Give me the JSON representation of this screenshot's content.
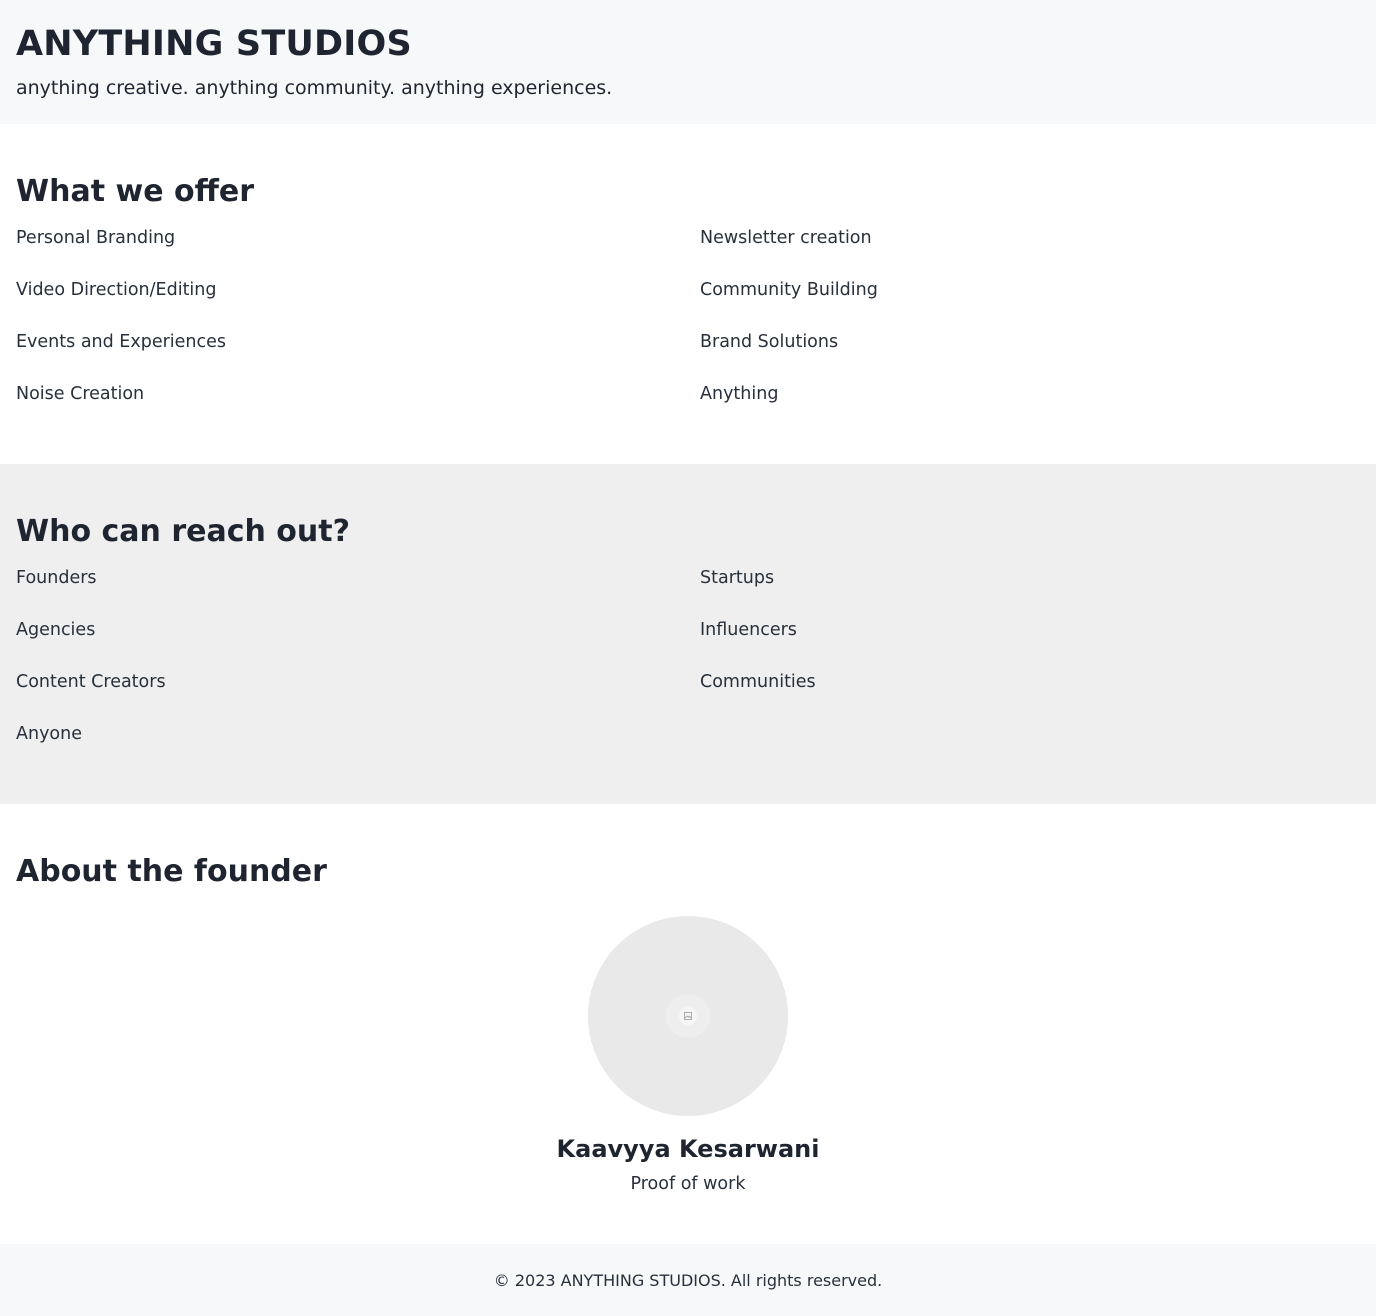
{
  "header": {
    "title": "ANYTHING STUDIOS",
    "tagline": "anything creative. anything community. anything experiences."
  },
  "offer": {
    "heading": "What we offer",
    "items": [
      "Personal Branding",
      "Newsletter creation",
      "Video Direction/Editing",
      "Community Building",
      "Events and Experiences",
      "Brand Solutions",
      "Noise Creation",
      "Anything"
    ]
  },
  "audience": {
    "heading": "Who can reach out?",
    "items": [
      "Founders",
      "Startups",
      "Agencies",
      "Influencers",
      "Content Creators",
      "Communities",
      "Anyone"
    ]
  },
  "founder": {
    "heading": "About the founder",
    "photo_icon": "image-placeholder-icon",
    "name": "Kaavyya Kesarwani",
    "link_label": "Proof of work"
  },
  "footer": {
    "copyright": "© 2023 ANYTHING STUDIOS. All rights reserved."
  },
  "colors": {
    "text": "#1f2530",
    "header_bg": "#f7f8f9",
    "alt_section_bg": "#efefef",
    "avatar_bg": "#e9e9e9"
  }
}
